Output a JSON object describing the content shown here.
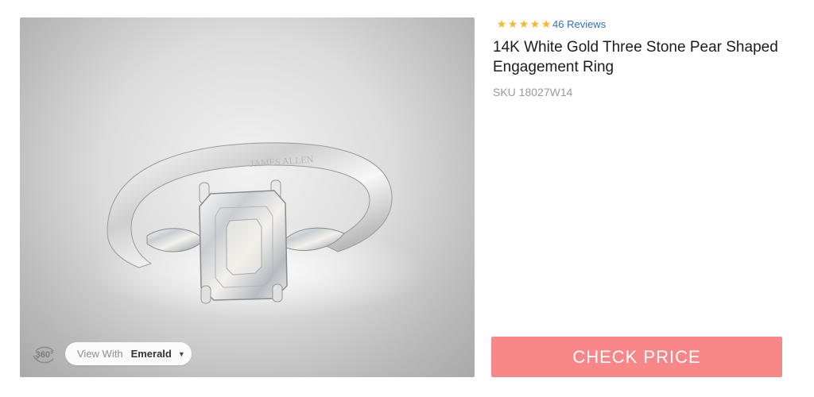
{
  "image": {
    "engraving": "JAMES ALLEN",
    "view_360_label": "360°",
    "metal_select": {
      "prefix": "View With",
      "value": "Emerald"
    }
  },
  "rating": {
    "stars": 5,
    "reviews_label": "46 Reviews",
    "star_color": "#f5b82a"
  },
  "product": {
    "title": "14K White Gold Three Stone Pear Shaped Engagement Ring",
    "sku": "SKU 18027W14"
  },
  "cta": {
    "label": "CHECK PRICE",
    "color": "#fa8787"
  }
}
